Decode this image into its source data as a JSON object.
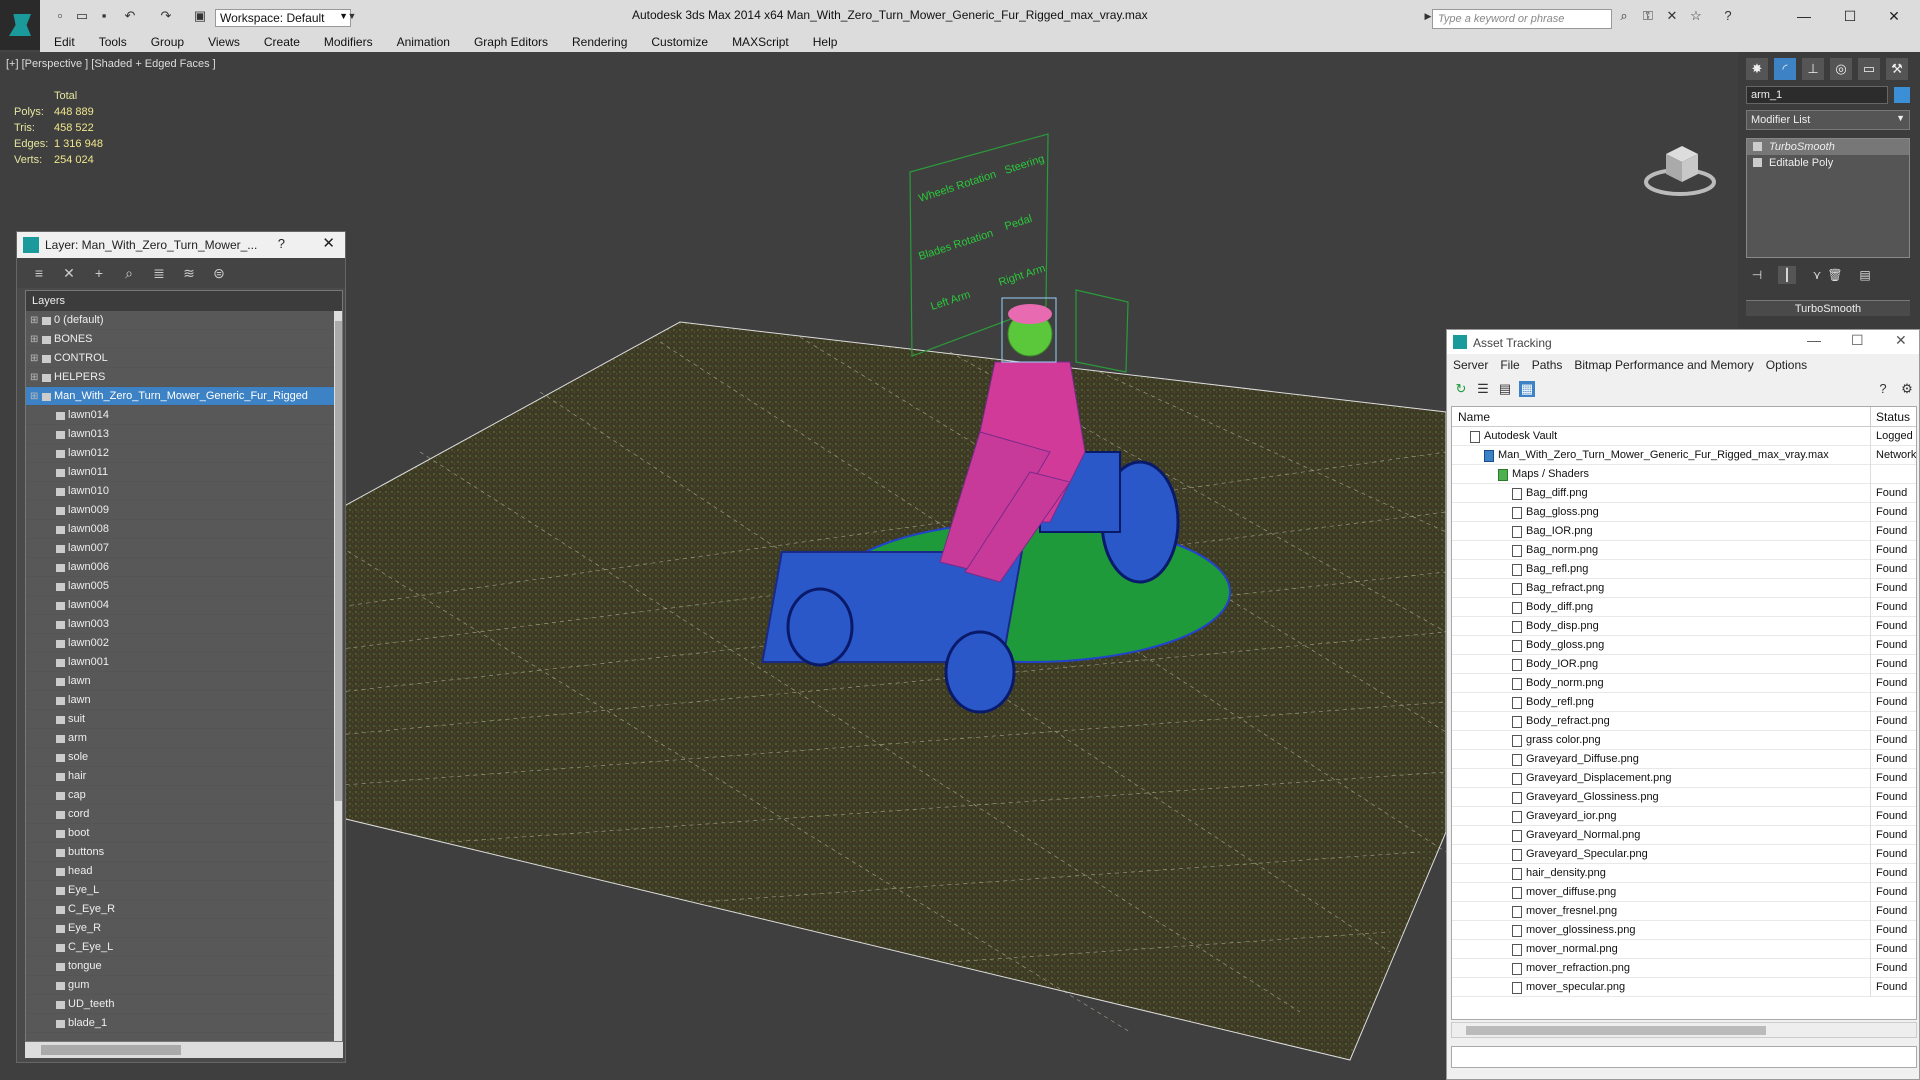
{
  "app": {
    "title": "Autodesk 3ds Max  2014 x64      Man_With_Zero_Turn_Mower_Generic_Fur_Rigged_max_vray.max",
    "workspace": "Workspace: Default",
    "search_placeholder": "Type a keyword or phrase"
  },
  "menu": [
    "Edit",
    "Tools",
    "Group",
    "Views",
    "Create",
    "Modifiers",
    "Animation",
    "Graph Editors",
    "Rendering",
    "Customize",
    "MAXScript",
    "Help"
  ],
  "viewport": {
    "label": "[+] [Perspective ] [Shaded + Edged Faces ]",
    "stats": {
      "header": "Total",
      "polys_label": "Polys:",
      "polys": "448 889",
      "tris_label": "Tris:",
      "tris": "458 522",
      "edges_label": "Edges:",
      "edges": "1 316 948",
      "verts_label": "Verts:",
      "verts": "254 024"
    },
    "rig_labels": [
      "Wheels Rotation",
      "Steering",
      "Blades Rotation",
      "Pedal",
      "Left Arm",
      "Right Arm"
    ]
  },
  "layer_panel": {
    "title": "Layer: Man_With_Zero_Turn_Mower_...",
    "help": "?",
    "header": "Layers",
    "layers": [
      {
        "name": "0 (default)",
        "level": 0,
        "expand": true
      },
      {
        "name": "BONES",
        "level": 0,
        "expand": true
      },
      {
        "name": "CONTROL",
        "level": 0,
        "expand": true
      },
      {
        "name": "HELPERS",
        "level": 0,
        "expand": true
      },
      {
        "name": "Man_With_Zero_Turn_Mower_Generic_Fur_Rigged",
        "level": 0,
        "expand": true,
        "selected": true
      },
      {
        "name": "lawn014",
        "level": 1
      },
      {
        "name": "lawn013",
        "level": 1
      },
      {
        "name": "lawn012",
        "level": 1
      },
      {
        "name": "lawn011",
        "level": 1
      },
      {
        "name": "lawn010",
        "level": 1
      },
      {
        "name": "lawn009",
        "level": 1
      },
      {
        "name": "lawn008",
        "level": 1
      },
      {
        "name": "lawn007",
        "level": 1
      },
      {
        "name": "lawn006",
        "level": 1
      },
      {
        "name": "lawn005",
        "level": 1
      },
      {
        "name": "lawn004",
        "level": 1
      },
      {
        "name": "lawn003",
        "level": 1
      },
      {
        "name": "lawn002",
        "level": 1
      },
      {
        "name": "lawn001",
        "level": 1
      },
      {
        "name": "lawn",
        "level": 1
      },
      {
        "name": "lawn",
        "level": 1
      },
      {
        "name": "suit",
        "level": 1
      },
      {
        "name": "arm",
        "level": 1
      },
      {
        "name": "sole",
        "level": 1
      },
      {
        "name": "hair",
        "level": 1
      },
      {
        "name": "cap",
        "level": 1
      },
      {
        "name": "cord",
        "level": 1
      },
      {
        "name": "boot",
        "level": 1
      },
      {
        "name": "buttons",
        "level": 1
      },
      {
        "name": "head",
        "level": 1
      },
      {
        "name": "Eye_L",
        "level": 1
      },
      {
        "name": "C_Eye_R",
        "level": 1
      },
      {
        "name": "Eye_R",
        "level": 1
      },
      {
        "name": "C_Eye_L",
        "level": 1
      },
      {
        "name": "tongue",
        "level": 1
      },
      {
        "name": "gum",
        "level": 1
      },
      {
        "name": "UD_teeth",
        "level": 1
      },
      {
        "name": "blade_1",
        "level": 1
      }
    ]
  },
  "command_panel": {
    "object_name": "arm_1",
    "modifier_list": "Modifier List",
    "stack": [
      "TurboSmooth",
      "Editable Poly"
    ],
    "rollout": "TurboSmooth",
    "colors": {
      "object": "#3b8fd6"
    }
  },
  "asset_tracking": {
    "title": "Asset Tracking",
    "menu": [
      "Server",
      "File",
      "Paths",
      "Bitmap Performance and Memory",
      "Options"
    ],
    "columns": {
      "name": "Name",
      "status": "Status"
    },
    "rows": [
      {
        "name": "Autodesk Vault",
        "status": "Logged",
        "level": 0
      },
      {
        "name": "Man_With_Zero_Turn_Mower_Generic_Fur_Rigged_max_vray.max",
        "status": "Network",
        "level": 1
      },
      {
        "name": "Maps / Shaders",
        "status": "",
        "level": 2
      },
      {
        "name": "Bag_diff.png",
        "status": "Found",
        "level": 3
      },
      {
        "name": "Bag_gloss.png",
        "status": "Found",
        "level": 3
      },
      {
        "name": "Bag_IOR.png",
        "status": "Found",
        "level": 3
      },
      {
        "name": "Bag_norm.png",
        "status": "Found",
        "level": 3
      },
      {
        "name": "Bag_refl.png",
        "status": "Found",
        "level": 3
      },
      {
        "name": "Bag_refract.png",
        "status": "Found",
        "level": 3
      },
      {
        "name": "Body_diff.png",
        "status": "Found",
        "level": 3
      },
      {
        "name": "Body_disp.png",
        "status": "Found",
        "level": 3
      },
      {
        "name": "Body_gloss.png",
        "status": "Found",
        "level": 3
      },
      {
        "name": "Body_IOR.png",
        "status": "Found",
        "level": 3
      },
      {
        "name": "Body_norm.png",
        "status": "Found",
        "level": 3
      },
      {
        "name": "Body_refl.png",
        "status": "Found",
        "level": 3
      },
      {
        "name": "Body_refract.png",
        "status": "Found",
        "level": 3
      },
      {
        "name": "grass color.png",
        "status": "Found",
        "level": 3
      },
      {
        "name": "Graveyard_Diffuse.png",
        "status": "Found",
        "level": 3
      },
      {
        "name": "Graveyard_Displacement.png",
        "status": "Found",
        "level": 3
      },
      {
        "name": "Graveyard_Glossiness.png",
        "status": "Found",
        "level": 3
      },
      {
        "name": "Graveyard_ior.png",
        "status": "Found",
        "level": 3
      },
      {
        "name": "Graveyard_Normal.png",
        "status": "Found",
        "level": 3
      },
      {
        "name": "Graveyard_Specular.png",
        "status": "Found",
        "level": 3
      },
      {
        "name": "hair_density.png",
        "status": "Found",
        "level": 3
      },
      {
        "name": "mover_diffuse.png",
        "status": "Found",
        "level": 3
      },
      {
        "name": "mover_fresnel.png",
        "status": "Found",
        "level": 3
      },
      {
        "name": "mover_glossiness.png",
        "status": "Found",
        "level": 3
      },
      {
        "name": "mover_normal.png",
        "status": "Found",
        "level": 3
      },
      {
        "name": "mover_refraction.png",
        "status": "Found",
        "level": 3
      },
      {
        "name": "mover_specular.png",
        "status": "Found",
        "level": 3
      }
    ]
  }
}
